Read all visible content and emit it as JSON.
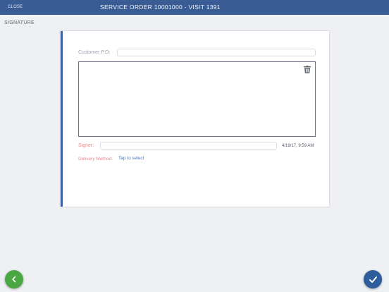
{
  "header": {
    "close_label": "CLOSE",
    "title": "SERVICE ORDER 10001000 - VISIT 1391"
  },
  "section": {
    "label": "SIGNATURE"
  },
  "form": {
    "customer_po_label": "Customer P.O:",
    "customer_po_value": "",
    "signer_label": "Signer:",
    "signer_value": "",
    "timestamp": "4/19/17, 9:59 AM",
    "delivery_method_label": "Delivery Method:",
    "delivery_method_value": "Tap to select"
  },
  "icons": {
    "trash": "trash-icon",
    "back": "chevron-left-icon",
    "confirm": "checkmark-icon"
  },
  "colors": {
    "header_bg": "#3a5c95",
    "accent": "#3e62a3",
    "required_label": "#e48a8a",
    "link": "#4a78c2",
    "back_button": "#4aa844",
    "confirm_button": "#2f5c9d"
  }
}
